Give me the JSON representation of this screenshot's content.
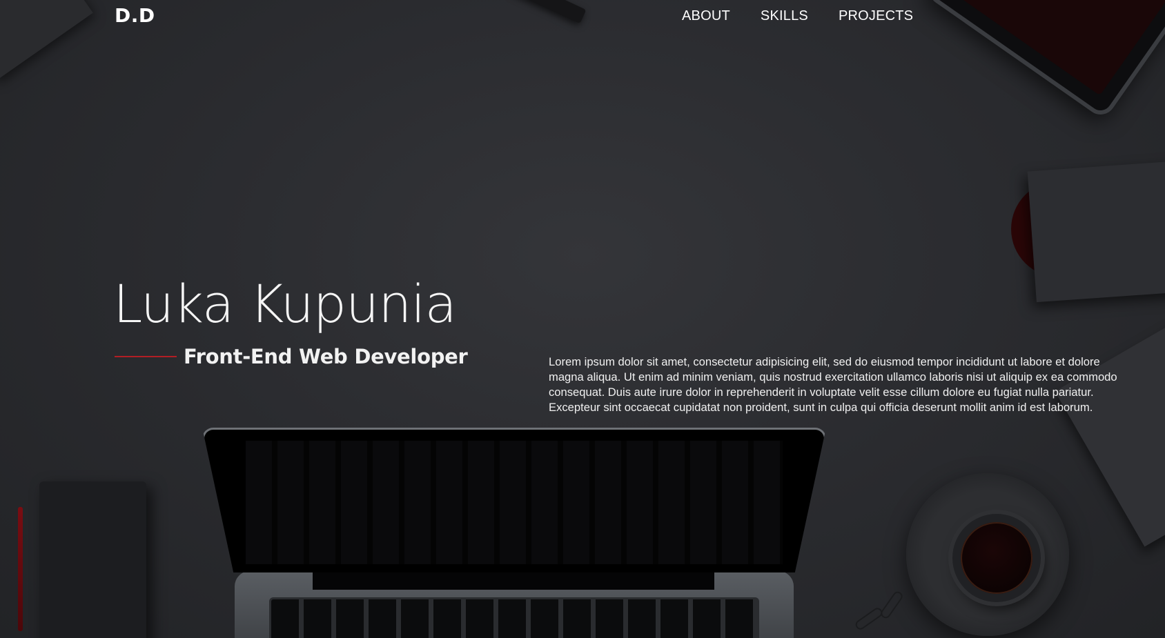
{
  "nav": {
    "logo": "D.D",
    "links": [
      "ABOUT",
      "SKILLS",
      "PROJECTS"
    ]
  },
  "hero": {
    "name": "Luka Kupunia",
    "role": "Front-End Web Developer",
    "bio": "Lorem ipsum dolor sit amet, consectetur adipisicing elit, sed do eiusmod tempor incididunt ut labore et dolore magna aliqua. Ut enim ad minim veniam, quis nostrud exercitation ullamco laboris nisi ut aliquip ex ea commodo consequat. Duis aute irure dolor in reprehenderit in voluptate velit esse cillum dolore eu fugiat nulla pariatur. Excepteur sint occaecat cupidatat non proident, sunt in culpa qui officia deserunt mollit anim id est laborum."
  },
  "colors": {
    "background": "#2b2c30",
    "accent": "#b21e24",
    "text": "#f2f2f2"
  }
}
